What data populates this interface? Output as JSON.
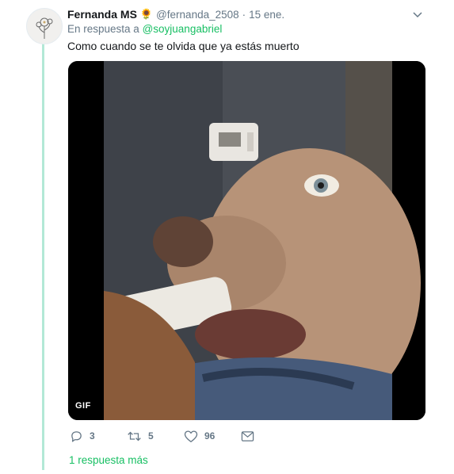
{
  "tweet": {
    "display_name": "Fernanda MS",
    "name_emoji": "🌻",
    "handle": "@fernanda_2508",
    "separator": "·",
    "date": "15 ene.",
    "reply_prefix": "En respuesta a",
    "reply_mention": "@soyjuangabriel",
    "text": "Como cuando se te olvida que ya estás muerto",
    "media_badge": "GIF"
  },
  "actions": {
    "reply_count": "3",
    "retweet_count": "5",
    "like_count": "96"
  },
  "thread": {
    "more_replies_label": "1 respuesta más"
  },
  "colors": {
    "accent": "#17bf63",
    "muted": "#657786",
    "thread_line": "#b3e8d6"
  }
}
